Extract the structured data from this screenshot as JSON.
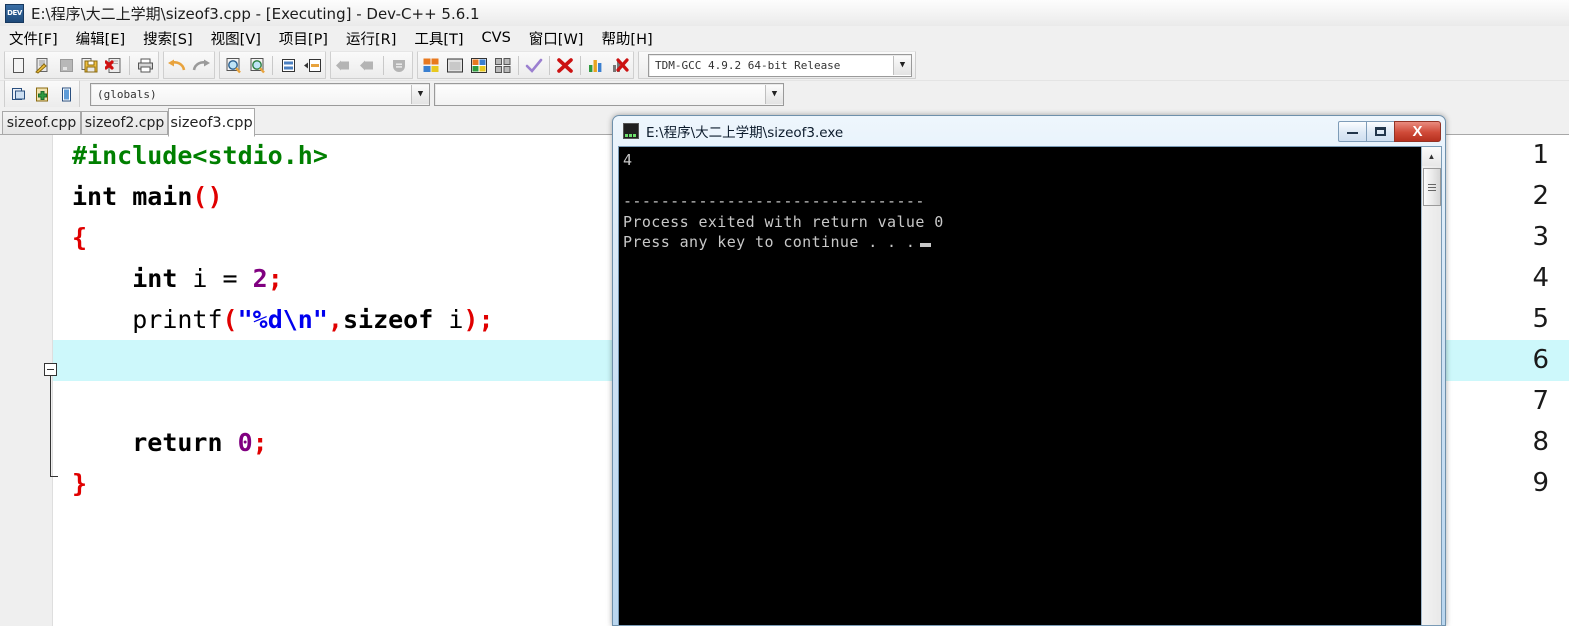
{
  "window": {
    "title": "E:\\程序\\大二上学期\\sizeof3.cpp - [Executing] - Dev-C++ 5.6.1",
    "app_icon": "dev-cpp-icon",
    "app_icon_label": "DEV"
  },
  "menubar": {
    "items": [
      {
        "label": "文件[F]",
        "name": "menu-file"
      },
      {
        "label": "编辑[E]",
        "name": "menu-edit"
      },
      {
        "label": "搜索[S]",
        "name": "menu-search"
      },
      {
        "label": "视图[V]",
        "name": "menu-view"
      },
      {
        "label": "项目[P]",
        "name": "menu-project"
      },
      {
        "label": "运行[R]",
        "name": "menu-run"
      },
      {
        "label": "工具[T]",
        "name": "menu-tools"
      },
      {
        "label": "CVS",
        "name": "menu-cvs"
      },
      {
        "label": "窗口[W]",
        "name": "menu-window"
      },
      {
        "label": "帮助[H]",
        "name": "menu-help"
      }
    ]
  },
  "toolbar": {
    "icons": [
      "new-file-icon",
      "open-file-icon",
      "save-icon",
      "save-all-icon",
      "close-file-icon",
      "print-icon",
      "undo-icon",
      "redo-icon",
      "find-icon",
      "replace-icon",
      "goto-line-icon",
      "goto-function-icon",
      "back-icon",
      "forward-icon",
      "toggle-breakpoint-icon",
      "compile-icon",
      "run-icon",
      "compile-run-icon",
      "rebuild-all-icon",
      "syntax-check-icon",
      "stop-execution-icon",
      "profile-icon",
      "delete-profile-icon"
    ],
    "compiler_combo": {
      "value": "TDM-GCC 4.9.2 64-bit Release",
      "arrow": "chevron-down-icon"
    }
  },
  "toolbar2": {
    "icons": [
      "project-browser-icon",
      "add-to-project-icon",
      "class-browser-icon"
    ],
    "globals_combo": {
      "value": "(globals)",
      "arrow": "chevron-down-icon"
    },
    "members_combo": {
      "value": "",
      "arrow": "chevron-down-icon"
    }
  },
  "tabs": [
    {
      "label": "sizeof.cpp",
      "active": false
    },
    {
      "label": "sizeof2.cpp",
      "active": false
    },
    {
      "label": "sizeof3.cpp",
      "active": true
    }
  ],
  "editor": {
    "current_line": 6,
    "highlight_color": "#cdf8fb",
    "fold_marker_line": 3,
    "line_numbers": [
      "1",
      "2",
      "3",
      "4",
      "5",
      "6",
      "7",
      "8",
      "9"
    ],
    "lines": [
      {
        "num": "1",
        "text": "#include<stdio.h>"
      },
      {
        "num": "2",
        "text": "int main()"
      },
      {
        "num": "3",
        "text": "{"
      },
      {
        "num": "4",
        "text": "    int i = 2;"
      },
      {
        "num": "5",
        "text": "    printf(\"%d\\n\",sizeof i);"
      },
      {
        "num": "6",
        "text": ""
      },
      {
        "num": "7",
        "text": ""
      },
      {
        "num": "8",
        "text": "    return 0;"
      },
      {
        "num": "9",
        "text": "}"
      }
    ],
    "tokens": {
      "l1": {
        "preproc": "#include<stdio.h>"
      },
      "l2": {
        "kw": "int",
        "id": " main",
        "paren": "()"
      },
      "l3": {
        "brace": "{"
      },
      "l4": {
        "indent": "    ",
        "kw": "int",
        "id": " i ",
        "op": "= ",
        "num": "2",
        "semi": ";"
      },
      "l5": {
        "indent": "    ",
        "id": "printf",
        "paren1": "(",
        "str": "\"%d\\n\"",
        "comma": ",",
        "kw": "sizeof",
        "id2": " i",
        "paren2": ")",
        "semi": ";"
      },
      "l8": {
        "indent": "    ",
        "kw": "return",
        "num": " 0",
        "semi": ";"
      },
      "l9": {
        "brace": "}"
      }
    },
    "colors": {
      "preprocessor": "#007f00",
      "keyword": "#000000",
      "string": "#0000ee",
      "number": "#800080",
      "punctuation": "#e00000",
      "background": "#ffffff",
      "gutter": "#efefef"
    }
  },
  "console": {
    "title": "E:\\程序\\大二上学期\\sizeof3.exe",
    "icon": "console-window-icon",
    "buttons": {
      "minimize": "minimize-icon",
      "maximize": "maximize-icon",
      "close": "X"
    },
    "output_lines": [
      "4",
      "",
      "--------------------------------",
      "Process exited with return value 0",
      "Press any key to continue . . ."
    ],
    "output_text": "4\n\n--------------------------------\nProcess exited with return value 0\nPress any key to continue . . .",
    "caret": "block-cursor",
    "colors": {
      "background": "#000000",
      "text": "#c8c8c8"
    },
    "scrollbar": {
      "up_arrow": "▲",
      "thumb": "scrollbar-thumb"
    }
  }
}
